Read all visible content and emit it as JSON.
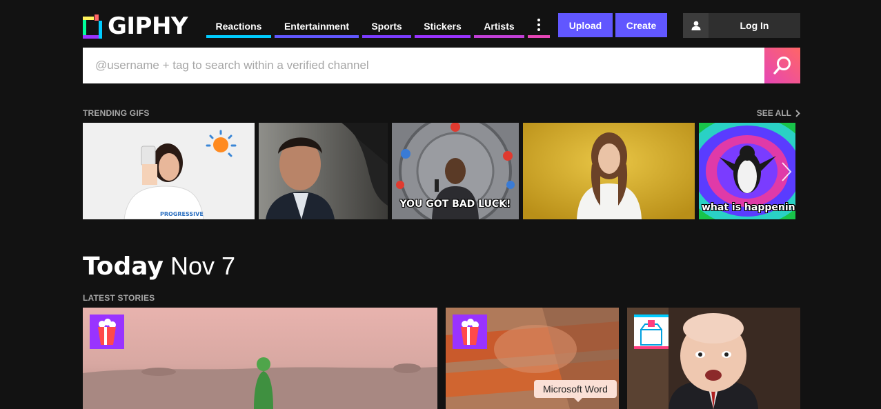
{
  "header": {
    "logo_text": "GIPHY",
    "nav": [
      {
        "label": "Reactions",
        "color": "#00ccff"
      },
      {
        "label": "Entertainment",
        "color": "#6157ff"
      },
      {
        "label": "Sports",
        "color": "#9933ff"
      },
      {
        "label": "Stickers",
        "color": "#9933ff"
      },
      {
        "label": "Artists",
        "color": "#e646b6"
      }
    ],
    "more_icon": "vertical-dots-icon",
    "upload_label": "Upload",
    "create_label": "Create",
    "login_label": "Log In",
    "accent_color": "#6157ff"
  },
  "search": {
    "placeholder": "@username + tag to search within a verified channel",
    "value": ""
  },
  "trending": {
    "label": "TRENDING GIFS",
    "see_all_label": "SEE ALL",
    "gifs": [
      {
        "caption": ""
      },
      {
        "caption": ""
      },
      {
        "caption": "YOU GOT BAD LUCK!"
      },
      {
        "caption": ""
      },
      {
        "caption": "what is happening"
      }
    ]
  },
  "today": {
    "bold": "Today",
    "date": "Nov 7"
  },
  "stories": {
    "label": "LATEST STORIES",
    "tooltip": "Microsoft Word"
  }
}
